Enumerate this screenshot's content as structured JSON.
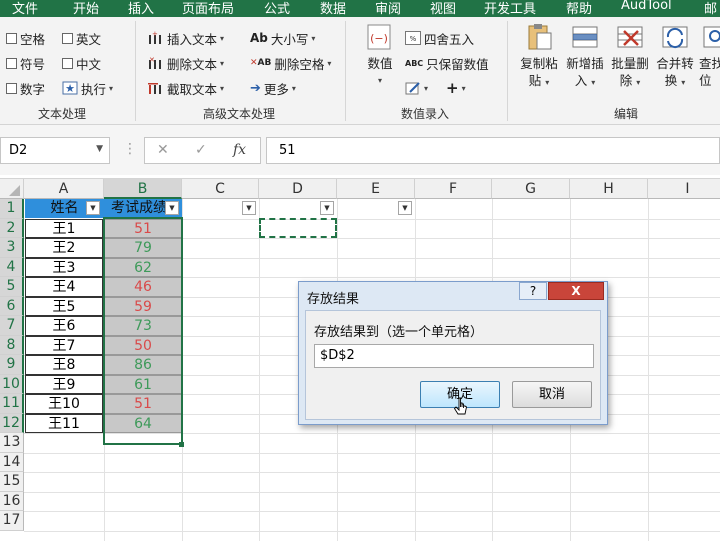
{
  "menu": [
    "文件",
    "开始",
    "插入",
    "页面布局",
    "公式",
    "数据",
    "审阅",
    "视图",
    "开发工具",
    "帮助",
    "AudTool",
    "邮"
  ],
  "ribbon": {
    "text_group": {
      "items": [
        "空格",
        "英文",
        "符号",
        "中文",
        "数字",
        "执行"
      ],
      "label": "文本处理"
    },
    "advanced_group": {
      "items": [
        "插入文本",
        "删除文本",
        "截取文本",
        "大小写",
        "删除空格",
        "更多"
      ],
      "label": "高级文本处理"
    },
    "value_group": {
      "big_button": "数值",
      "items": [
        "四舍五入",
        "只保留数值"
      ],
      "label": "数值录入",
      "abc": "ABC",
      "plus": "+"
    },
    "edit_group": {
      "buttons": [
        [
          "复制粘",
          "贴"
        ],
        [
          "新增插",
          "入"
        ],
        [
          "批量删",
          "除"
        ],
        [
          "合并转",
          "换"
        ],
        [
          "查找",
          "位"
        ]
      ],
      "label": "编辑"
    }
  },
  "formula_bar": {
    "name_box": "D2",
    "value": "51",
    "cancel": "✕",
    "enter": "✓",
    "fx": "fx"
  },
  "grid": {
    "columns": [
      "A",
      "B",
      "C",
      "D",
      "E",
      "F",
      "G",
      "H",
      "I"
    ],
    "rows": [
      "1",
      "2",
      "3",
      "4",
      "5",
      "6",
      "7",
      "8",
      "9",
      "10",
      "11",
      "12",
      "13",
      "14",
      "15",
      "16",
      "17"
    ],
    "header_name": "姓名",
    "header_score": "考试成绩",
    "data": [
      {
        "name": "王1",
        "score": "51",
        "color": "#d94a4a"
      },
      {
        "name": "王2",
        "score": "79",
        "color": "#3e9a5a"
      },
      {
        "name": "王3",
        "score": "62",
        "color": "#3e9a5a"
      },
      {
        "name": "王4",
        "score": "46",
        "color": "#d94a4a"
      },
      {
        "name": "王5",
        "score": "59",
        "color": "#d94a4a"
      },
      {
        "name": "王6",
        "score": "73",
        "color": "#3e9a5a"
      },
      {
        "name": "王7",
        "score": "50",
        "color": "#d94a4a"
      },
      {
        "name": "王8",
        "score": "86",
        "color": "#3e9a5a"
      },
      {
        "name": "王9",
        "score": "61",
        "color": "#3e9a5a"
      },
      {
        "name": "王10",
        "score": "51",
        "color": "#d94a4a"
      },
      {
        "name": "王11",
        "score": "64",
        "color": "#3e9a5a"
      }
    ]
  },
  "dialog": {
    "title": "存放结果",
    "help": "?",
    "close": "X",
    "label": "存放结果到（选一个单元格）",
    "value": "$D$2",
    "ok": "确定",
    "cancel": "取消"
  },
  "colors": {
    "accent": "#217346",
    "header_fill": "#2f8fdc",
    "fail": "#d94a4a",
    "pass": "#3e9a5a"
  }
}
